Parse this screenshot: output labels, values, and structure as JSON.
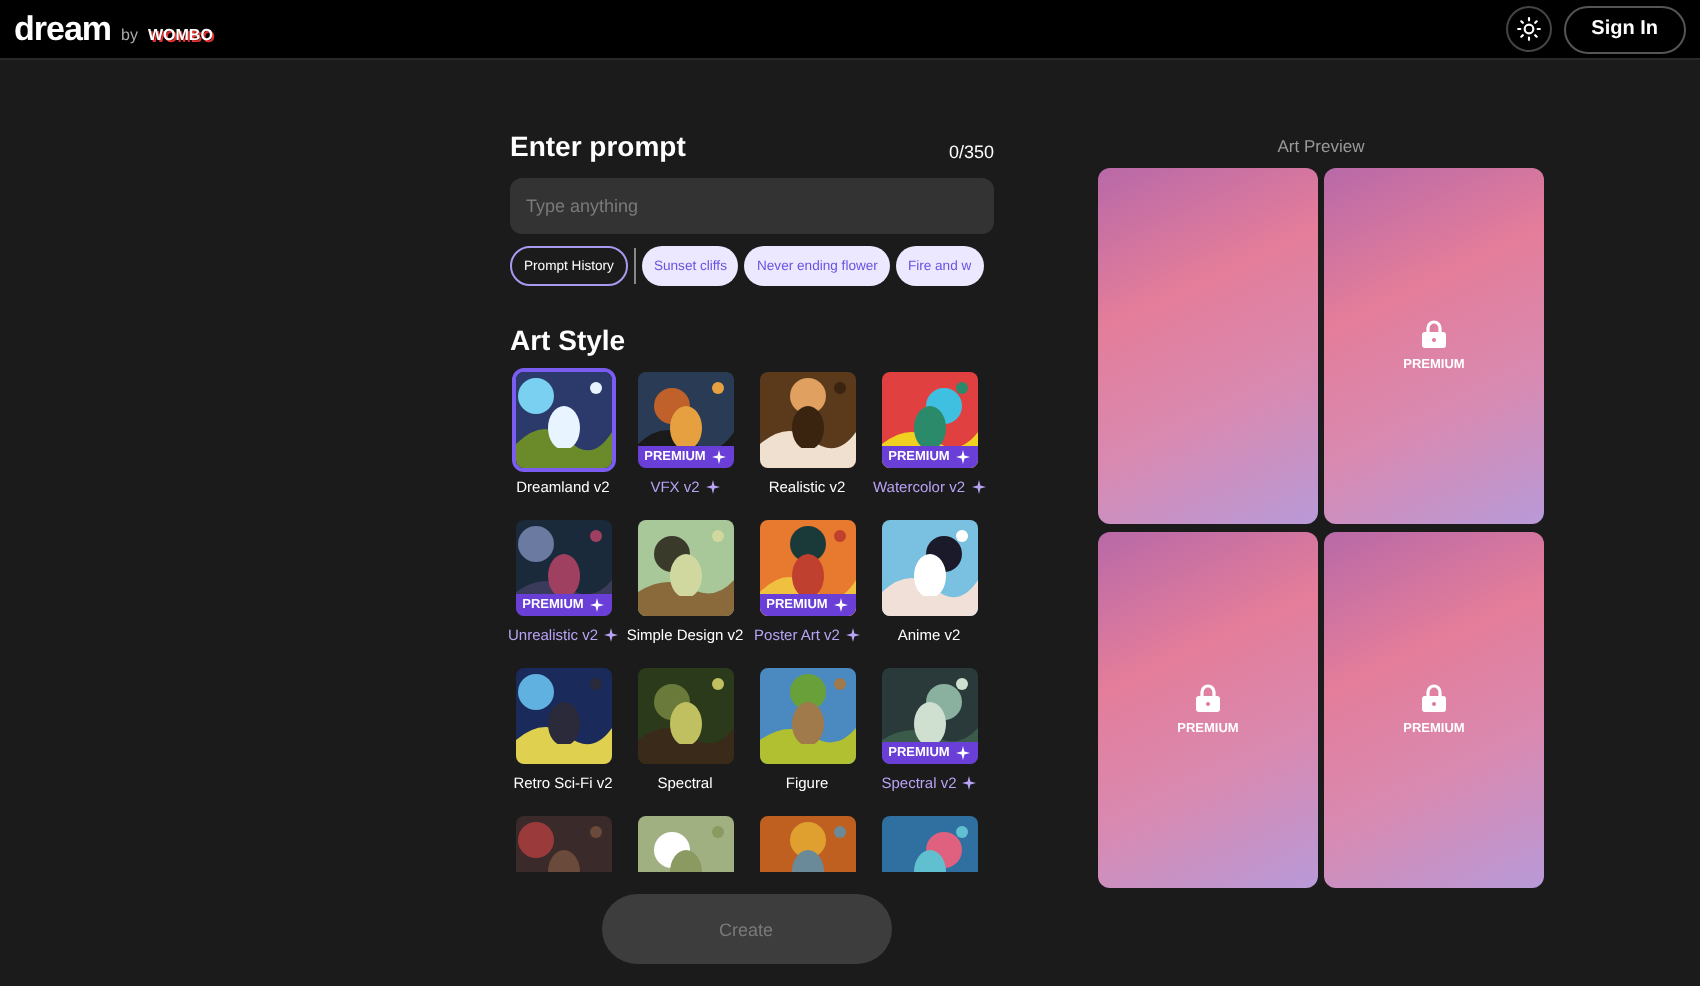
{
  "header": {
    "logo": "dream",
    "by": "by",
    "brand": "WOMBO",
    "sign_in": "Sign In"
  },
  "prompt": {
    "title": "Enter prompt",
    "counter": "0/350",
    "placeholder": "Type anything",
    "history": "Prompt History",
    "suggestions": [
      "Sunset cliffs",
      "Never ending flower",
      "Fire and w"
    ]
  },
  "art_style": {
    "title": "Art Style",
    "create": "Create",
    "styles": [
      {
        "name": "Dreamland v2",
        "premium": false,
        "selected": true
      },
      {
        "name": "VFX v2",
        "premium": true,
        "badge": "PREMIUM",
        "selected": false
      },
      {
        "name": "Realistic v2",
        "premium": false,
        "selected": false
      },
      {
        "name": "Watercolor v2",
        "premium": true,
        "badge": "PREMIUM",
        "selected": false
      },
      {
        "name": "Unrealistic v2",
        "premium": true,
        "badge": "PREMIUM",
        "selected": false
      },
      {
        "name": "Simple Design v2",
        "premium": false,
        "selected": false
      },
      {
        "name": "Poster Art v2",
        "premium": true,
        "badge": "PREMIUM",
        "selected": false
      },
      {
        "name": "Anime v2",
        "premium": false,
        "selected": false
      },
      {
        "name": "Retro Sci-Fi v2",
        "premium": false,
        "selected": false
      },
      {
        "name": "Spectral",
        "premium": false,
        "selected": false
      },
      {
        "name": "Figure",
        "premium": false,
        "selected": false
      },
      {
        "name": "Spectral v2",
        "premium": true,
        "badge": "PREMIUM",
        "selected": false
      },
      {
        "selected": false
      },
      {
        "selected": false
      },
      {
        "selected": false
      },
      {
        "selected": false
      }
    ]
  },
  "preview": {
    "title": "Art Preview",
    "cards": [
      {
        "premium": false
      },
      {
        "premium": true,
        "label": "PREMIUM"
      },
      {
        "premium": true,
        "label": "PREMIUM"
      },
      {
        "premium": true,
        "label": "PREMIUM"
      }
    ]
  }
}
